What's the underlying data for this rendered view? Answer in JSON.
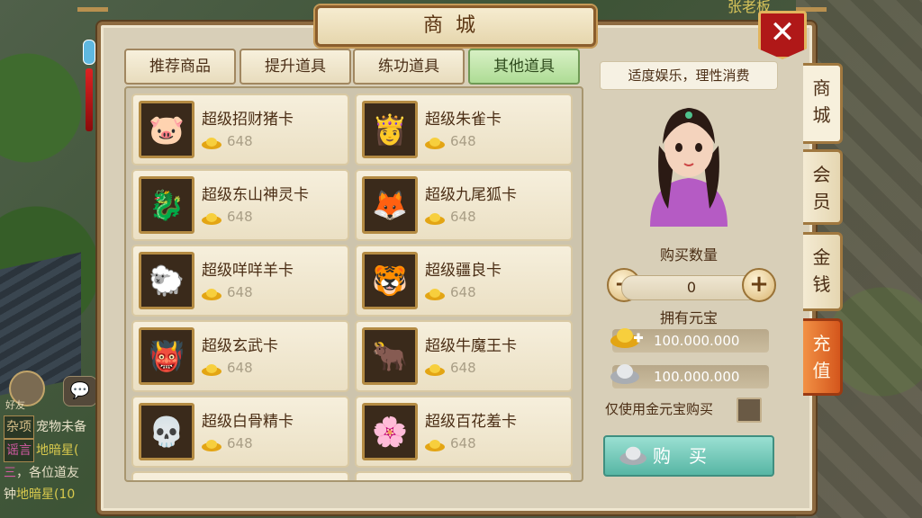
{
  "scene": {
    "npc_name": "张老板"
  },
  "chat": {
    "lines": [
      {
        "tag": "杂项",
        "text": "宠物未备"
      },
      {
        "tag": "谣言",
        "text": "地暗星("
      },
      {
        "prefix": "三",
        "text": "，各位道友"
      },
      {
        "prefix": "钟",
        "text": "地暗星(10"
      }
    ],
    "avatar_label": "好友"
  },
  "panel": {
    "title": "商城"
  },
  "tabs": [
    {
      "label": "推荐商品",
      "active": false
    },
    {
      "label": "提升道具",
      "active": false
    },
    {
      "label": "练功道具",
      "active": false
    },
    {
      "label": "其他道具",
      "active": true
    }
  ],
  "items": [
    {
      "name": "超级招财猪卡",
      "price": "648",
      "icon": "🐷"
    },
    {
      "name": "超级朱雀卡",
      "price": "648",
      "icon": "👸"
    },
    {
      "name": "超级东山神灵卡",
      "price": "648",
      "icon": "🐉"
    },
    {
      "name": "超级九尾狐卡",
      "price": "648",
      "icon": "🦊"
    },
    {
      "name": "超级咩咩羊卡",
      "price": "648",
      "icon": "🐑"
    },
    {
      "name": "超级疆良卡",
      "price": "648",
      "icon": "🐯"
    },
    {
      "name": "超级玄武卡",
      "price": "648",
      "icon": "👹"
    },
    {
      "name": "超级牛魔王卡",
      "price": "648",
      "icon": "🐂"
    },
    {
      "name": "超级白骨精卡",
      "price": "648",
      "icon": "💀"
    },
    {
      "name": "超级百花羞卡",
      "price": "648",
      "icon": "🌸"
    }
  ],
  "side": {
    "slogan": "适度娱乐，理性消费",
    "qty_label": "购买数量",
    "qty_value": "0",
    "owned_label": "拥有元宝",
    "gold_amount": "100.000.000",
    "silver_amount": "100.000.000",
    "only_gold_label": "仅使用金元宝购买",
    "buy_label": "购买"
  },
  "vtabs": [
    {
      "label": "商城",
      "active": true
    },
    {
      "label": "会员",
      "active": false
    },
    {
      "label": "金钱",
      "active": false
    },
    {
      "label": "充值",
      "active": false
    }
  ],
  "colors": {
    "panel": "#d8cfb8",
    "active_tab": "#aedc95",
    "buy_button": "#57b6a4",
    "recharge": "#d4561c",
    "close": "#b01818"
  }
}
